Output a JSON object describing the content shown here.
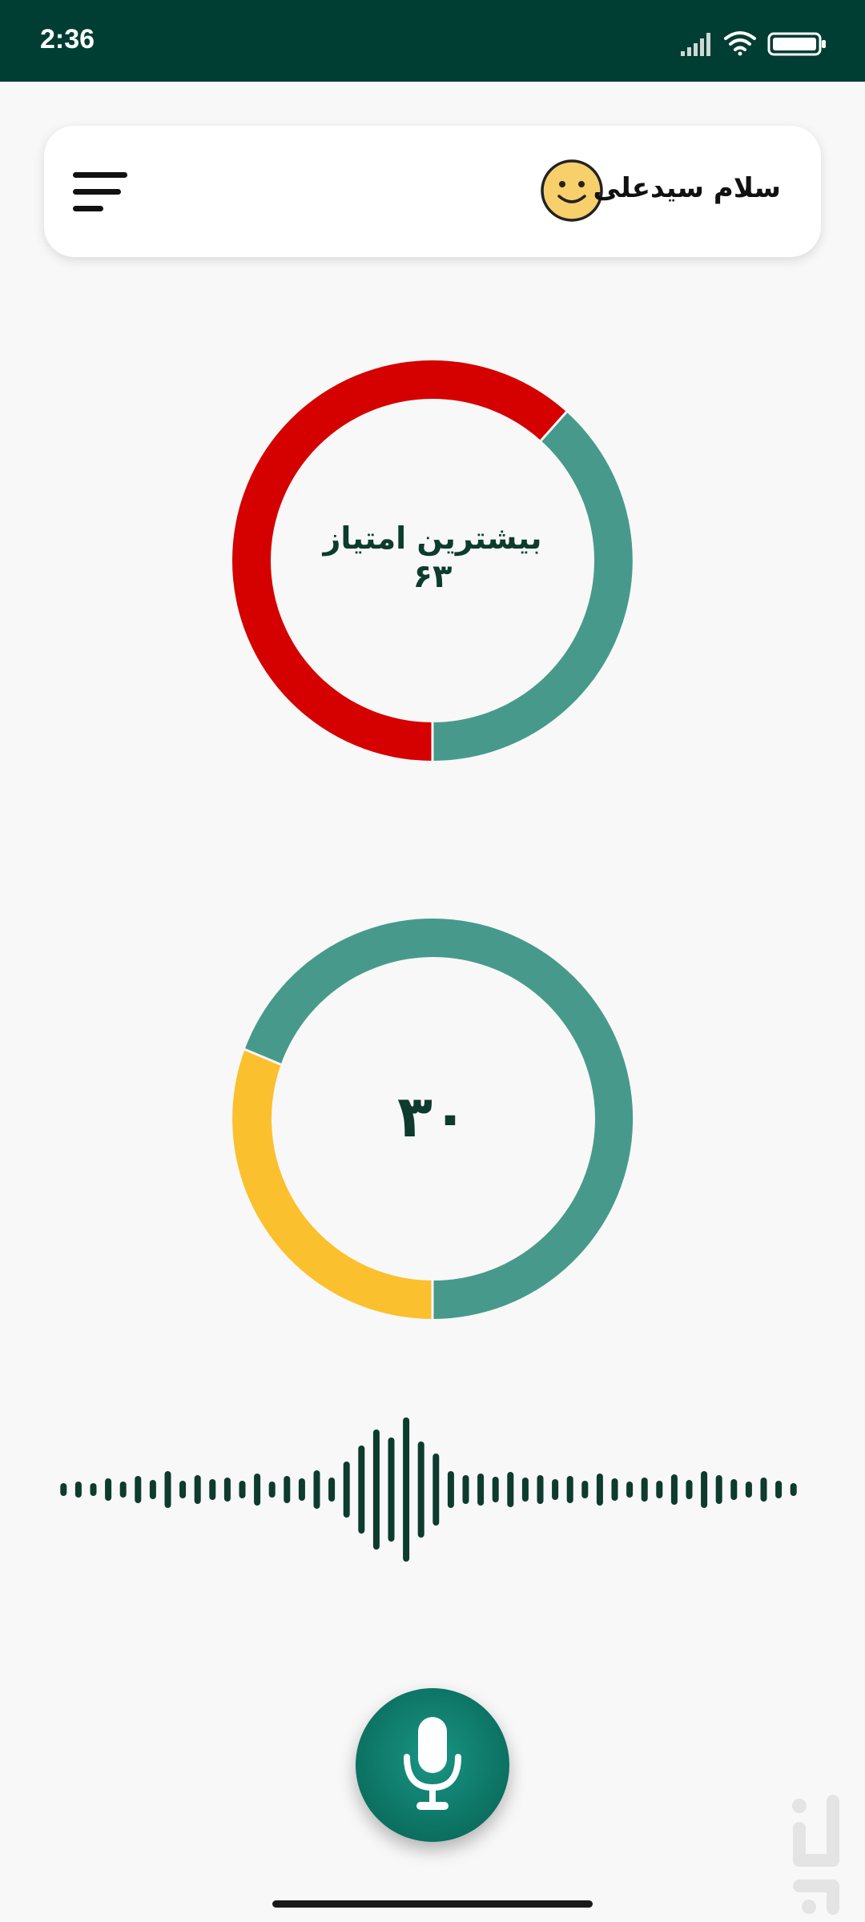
{
  "status_bar": {
    "time": "2:36"
  },
  "header": {
    "greeting": "سلام سیدعلی"
  },
  "score_ring": {
    "title": "بیشترین امتیاز",
    "value": "۶۳",
    "colors": [
      "#d50000",
      "#479a8b"
    ]
  },
  "current_ring": {
    "value": "۳۰",
    "colors": [
      "#479a8b",
      "#fbc02d"
    ]
  },
  "colors": {
    "status_bar": "#003d33",
    "wave": "#0d3b2e",
    "mic": "#0d7565"
  }
}
